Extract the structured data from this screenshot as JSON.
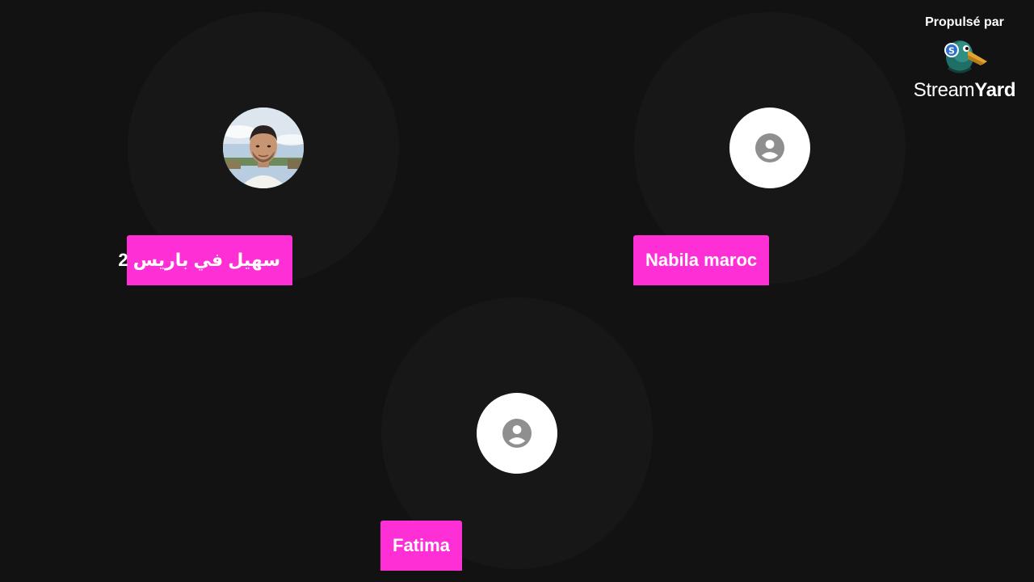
{
  "participants": [
    {
      "name": "سهيل في باريس 2",
      "avatar": "photo"
    },
    {
      "name": "Nabila maroc",
      "avatar": "person-icon"
    },
    {
      "name": "Fatima",
      "avatar": "person-icon"
    }
  ],
  "branding": {
    "powered_by": "Propulsé par",
    "brand_part1": "Stream",
    "brand_part2": "Yard",
    "logo_icon": "duck-mascot-icon"
  },
  "colors": {
    "background": "#121212",
    "tile": "#171717",
    "name_tag": "#ff2fd6",
    "avatar_placeholder": "#ffffff",
    "person_icon": "#8f8f8f"
  }
}
